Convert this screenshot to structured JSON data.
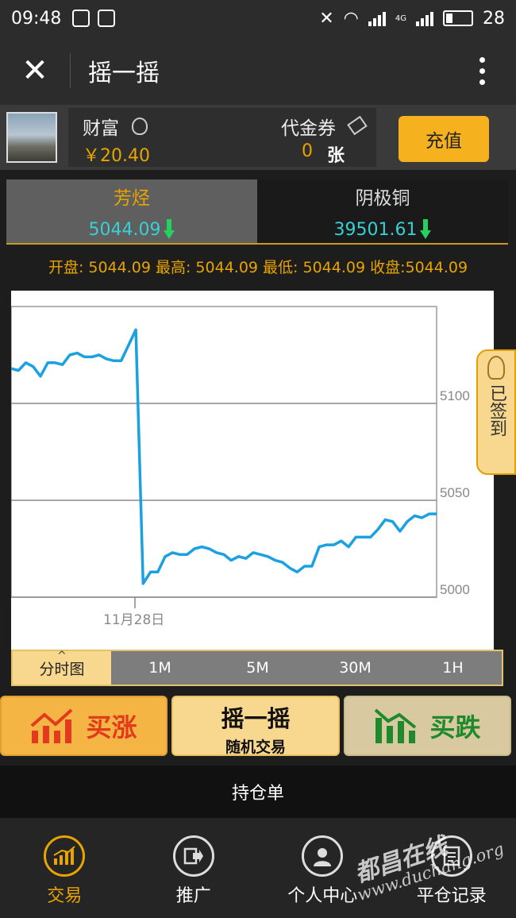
{
  "status_bar": {
    "time": "09:48",
    "battery": "28",
    "network": "4G"
  },
  "nav": {
    "title": "摇一摇"
  },
  "wallet": {
    "wealth_label": "财富",
    "wealth_value": "￥20.40",
    "coupon_label": "代金券",
    "coupon_value": "0",
    "coupon_unit": "张",
    "recharge_label": "充值"
  },
  "tabs": [
    {
      "name": "芳烃",
      "price": "5044.09"
    },
    {
      "name": "阴极铜",
      "price": "39501.61"
    }
  ],
  "ohlc_text": "开盘: 5044.09  最高: 5044.09  最低: 5044.09  收盘:5044.09",
  "signin_label": "已签到",
  "periods": [
    "分时图",
    "1M",
    "5M",
    "30M",
    "1H"
  ],
  "trade": {
    "buy_up": "买涨",
    "shake_main": "摇一摇",
    "shake_sub": "随机交易",
    "buy_down": "买跌"
  },
  "positions_label": "持仓单",
  "bottom_nav": [
    "交易",
    "推广",
    "个人中心",
    "平仓记录"
  ],
  "watermark": {
    "line1": "都昌在线",
    "line2": "www.duchang.org"
  },
  "colors": {
    "accent": "#e8a400",
    "line": "#1ba1e2",
    "price": "#38d0d3",
    "down": "#25d060"
  },
  "chart_data": {
    "type": "line",
    "x_tick_label": "11月28日",
    "y_ticks": [
      5000,
      5050,
      5100
    ],
    "ylim": [
      5000,
      5150
    ],
    "series": [
      {
        "values": [
          5118,
          5117,
          5121,
          5119,
          5114,
          5121,
          5121,
          5120,
          5125,
          5126,
          5124,
          5124,
          5125,
          5123,
          5122,
          5122,
          5130,
          5138,
          5007,
          5013,
          5013,
          5021,
          5023,
          5022,
          5022,
          5025,
          5026,
          5025,
          5023,
          5022,
          5019,
          5021,
          5020,
          5023,
          5022,
          5021,
          5019,
          5018,
          5015,
          5013,
          5016,
          5016,
          5026,
          5027,
          5027,
          5029,
          5026,
          5031,
          5031,
          5031,
          5035,
          5040,
          5039,
          5034,
          5039,
          5042,
          5041,
          5043,
          5043
        ]
      }
    ]
  }
}
